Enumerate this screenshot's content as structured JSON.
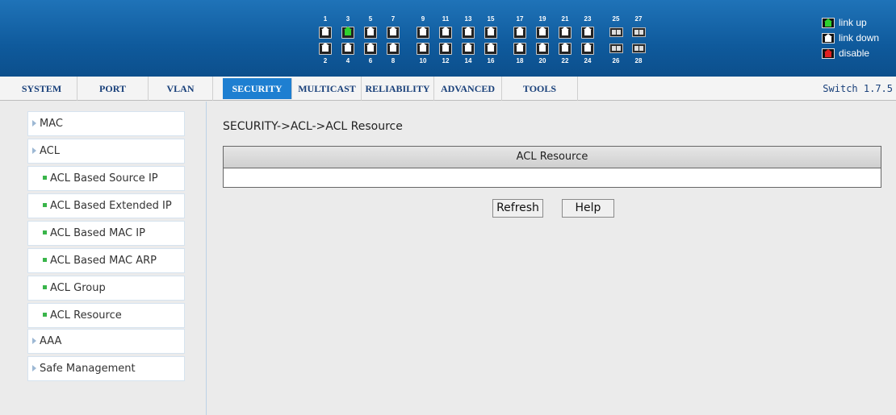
{
  "header": {
    "ports_top_odd": [
      "1",
      "3",
      "5",
      "7",
      "9",
      "11",
      "13",
      "15",
      "17",
      "19",
      "21",
      "23",
      "25",
      "27"
    ],
    "ports_bottom_even": [
      "2",
      "4",
      "6",
      "8",
      "10",
      "12",
      "14",
      "16",
      "18",
      "20",
      "22",
      "24",
      "26",
      "28"
    ],
    "port_icon": "port-icon",
    "sfp_icon": "sfp-icon",
    "port_status_up": [
      "3"
    ],
    "legend": {
      "link_up": "link up",
      "link_down": "link down",
      "disable": "disable"
    },
    "colors": {
      "link_up": "#2fd12f",
      "link_down": "#ffffff",
      "disable": "#e02020",
      "header_bg": "#1367ae"
    }
  },
  "nav": {
    "tabs": [
      "SYSTEM",
      "PORT",
      "VLAN",
      "SECURITY",
      "MULTICAST",
      "RELIABILITY",
      "ADVANCED",
      "TOOLS"
    ],
    "active": "SECURITY",
    "version": "Switch 1.7.5"
  },
  "sidebar": {
    "items": [
      {
        "label": "MAC",
        "level": 1
      },
      {
        "label": "ACL",
        "level": 1
      },
      {
        "label": "ACL Based Source IP",
        "level": 2
      },
      {
        "label": "ACL Based Extended IP",
        "level": 2
      },
      {
        "label": "ACL Based MAC IP",
        "level": 2
      },
      {
        "label": "ACL Based MAC ARP",
        "level": 2
      },
      {
        "label": "ACL Group",
        "level": 2
      },
      {
        "label": "ACL Resource",
        "level": 2
      },
      {
        "label": "AAA",
        "level": 1
      },
      {
        "label": "Safe Management",
        "level": 1
      }
    ]
  },
  "main": {
    "breadcrumb": "SECURITY->ACL->ACL Resource",
    "table_title": "ACL Resource",
    "refresh_label": "Refresh",
    "help_label": "Help"
  }
}
